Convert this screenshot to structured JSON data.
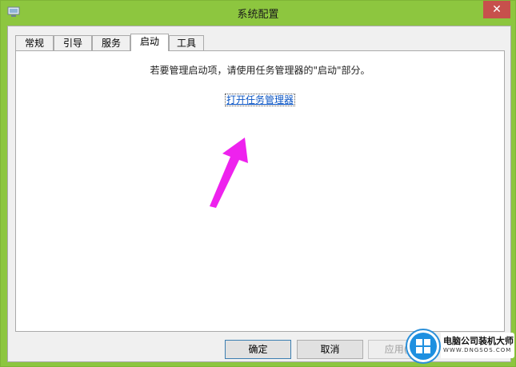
{
  "window": {
    "title": "系统配置",
    "close_label": "✕",
    "accent": "#8dc63f",
    "close_color": "#c7504c"
  },
  "tabs": [
    {
      "label": "常规",
      "active": false
    },
    {
      "label": "引导",
      "active": false
    },
    {
      "label": "服务",
      "active": false
    },
    {
      "label": "启动",
      "active": true
    },
    {
      "label": "工具",
      "active": false
    }
  ],
  "startup": {
    "message": "若要管理启动项，请使用任务管理器的\"启动\"部分。",
    "link": "打开任务管理器",
    "link_color": "#0b55c4"
  },
  "annotation": {
    "color": "#ee22ee"
  },
  "buttons": {
    "ok": "确定",
    "cancel": "取消",
    "apply": "应用(A)"
  },
  "watermark": {
    "title": "电脑公司装机大师",
    "subtitle": "WWW.DNGSOS.COM"
  }
}
